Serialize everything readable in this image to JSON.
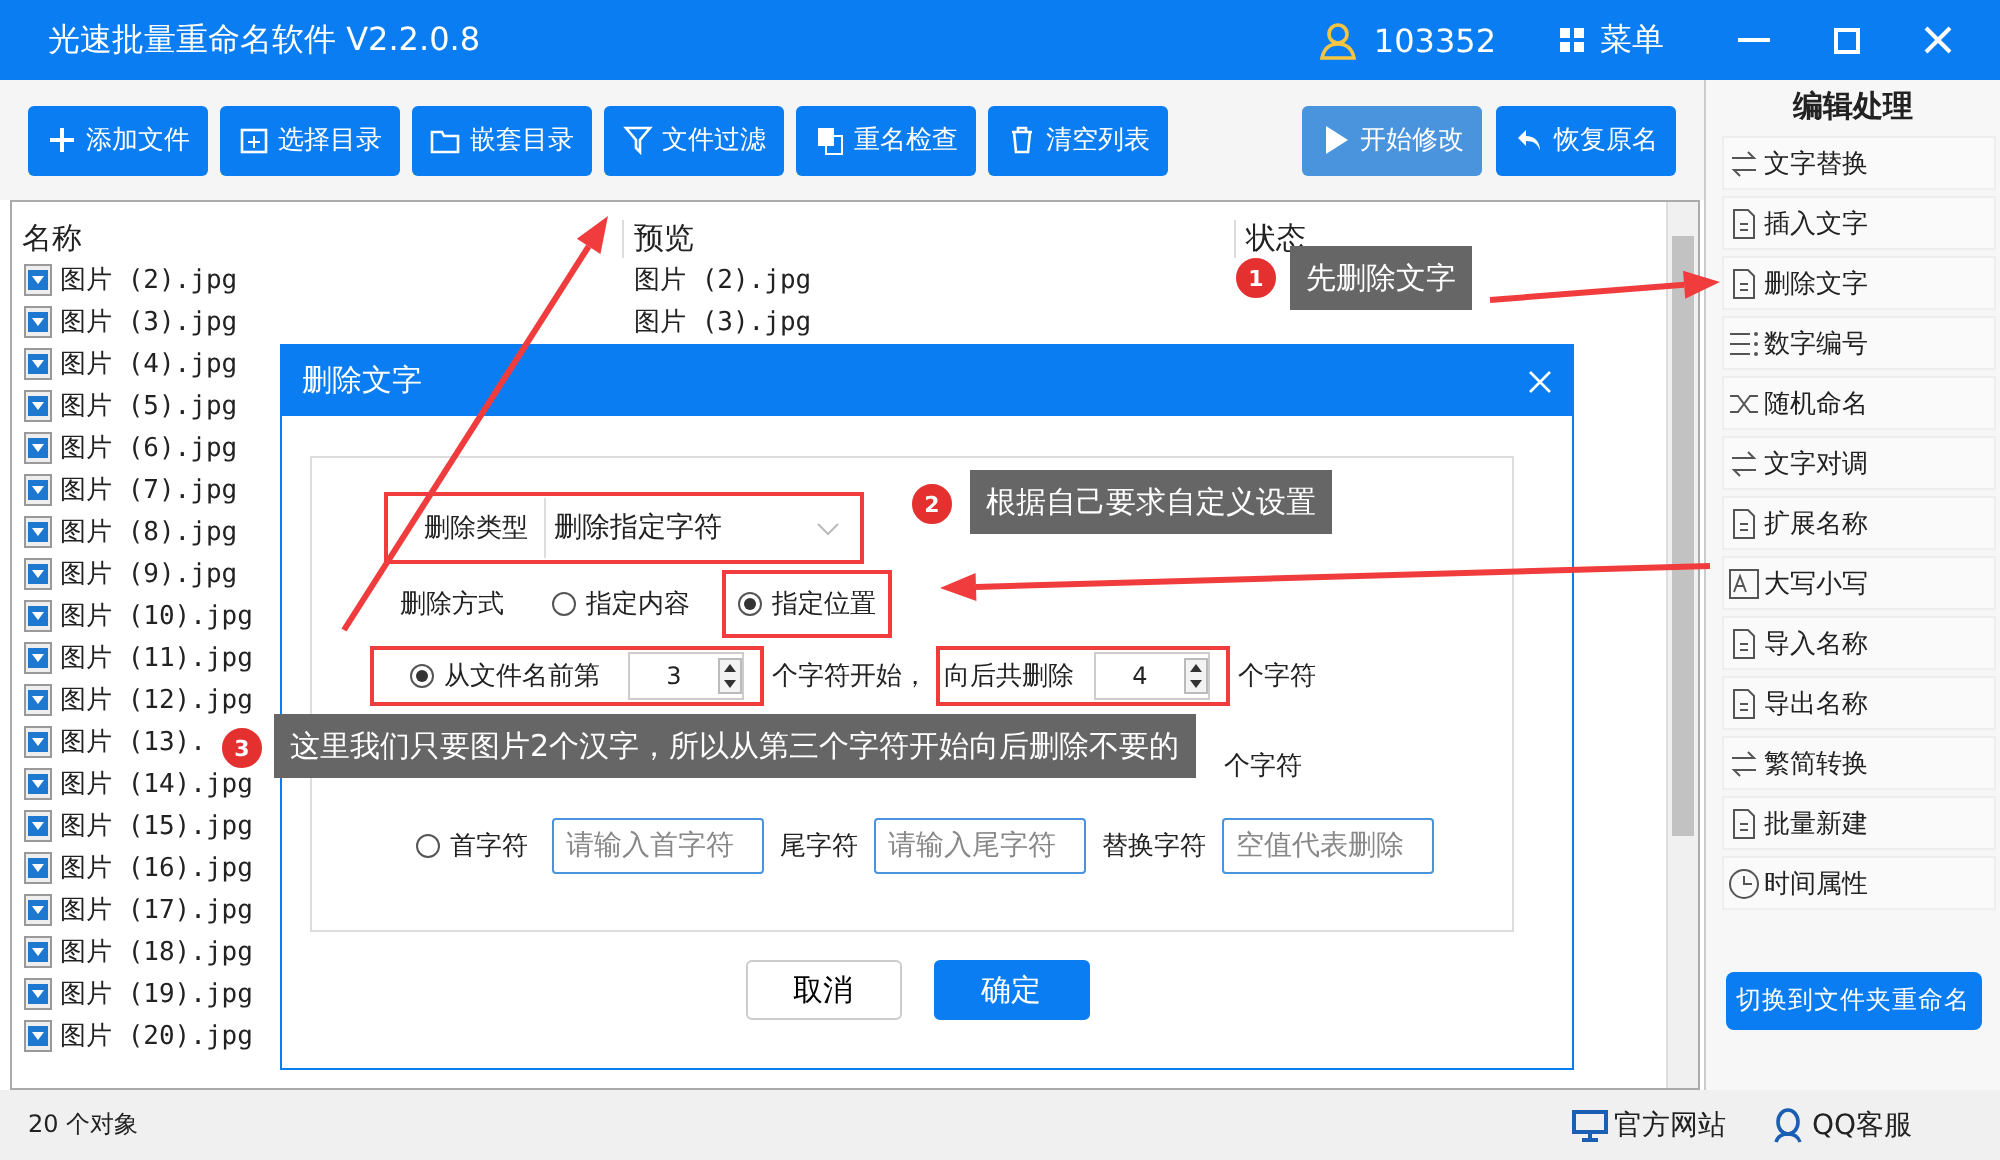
{
  "window": {
    "title": "光速批量重命名软件 V2.2.0.8",
    "user_id": "103352",
    "menu_label": "菜单"
  },
  "toolbar": [
    {
      "label": "添加文件",
      "disabled": false
    },
    {
      "label": "选择目录",
      "disabled": false
    },
    {
      "label": "嵌套目录",
      "disabled": false
    },
    {
      "label": "文件过滤",
      "disabled": false
    },
    {
      "label": "重名检查",
      "disabled": false
    },
    {
      "label": "清空列表",
      "disabled": false
    }
  ],
  "toolbar_right": [
    {
      "label": "开始修改",
      "disabled": true
    },
    {
      "label": "恢复原名",
      "disabled": false
    }
  ],
  "file_list": {
    "columns": [
      "名称",
      "预览",
      "状态"
    ],
    "rows": [
      {
        "name": "图片 (2).jpg",
        "preview": "图片 (2).jpg"
      },
      {
        "name": "图片 (3).jpg",
        "preview": "图片 (3).jpg"
      },
      {
        "name": "图片 (4).jpg"
      },
      {
        "name": "图片 (5).jpg"
      },
      {
        "name": "图片 (6).jpg"
      },
      {
        "name": "图片 (7).jpg"
      },
      {
        "name": "图片 (8).jpg"
      },
      {
        "name": "图片 (9).jpg"
      },
      {
        "name": "图片 (10).jpg"
      },
      {
        "name": "图片 (11).jpg"
      },
      {
        "name": "图片 (12).jpg"
      },
      {
        "name": "图片 (13)."
      },
      {
        "name": "图片 (14).jpg"
      },
      {
        "name": "图片 (15).jpg"
      },
      {
        "name": "图片 (16).jpg"
      },
      {
        "name": "图片 (17).jpg"
      },
      {
        "name": "图片 (18).jpg"
      },
      {
        "name": "图片 (19).jpg"
      },
      {
        "name": "图片 (20).jpg"
      }
    ]
  },
  "sidebar": {
    "title": "编辑处理",
    "items": [
      "文字替换",
      "插入文字",
      "删除文字",
      "数字编号",
      "随机命名",
      "文字对调",
      "扩展名称",
      "大写小写",
      "导入名称",
      "导出名称",
      "繁简转换",
      "批量新建",
      "时间属性"
    ],
    "switch_button": "切换到文件夹重命名"
  },
  "status_bar": {
    "count": "20 个对象",
    "links": [
      "官方网站",
      "QQ客服"
    ]
  },
  "dialog": {
    "title": "删除文字",
    "type_label": "删除类型",
    "type_value": "删除指定字符",
    "mode_label": "删除方式",
    "modes": [
      {
        "label": "指定内容",
        "selected": false
      },
      {
        "label": "指定位置",
        "selected": true
      }
    ],
    "front_option": {
      "selected": true,
      "label": "从文件名前第",
      "start": "3",
      "middle": "个字符开始，",
      "count_label": "向后共删除",
      "count": "4",
      "suffix": "个字符"
    },
    "back_option": {
      "suffix": "个字符"
    },
    "char_option": {
      "selected": false,
      "label": "首字符",
      "first_placeholder": "请输入首字符",
      "last_label": "尾字符",
      "last_placeholder": "请输入尾字符",
      "replace_label": "替换字符",
      "replace_placeholder": "空值代表删除"
    },
    "buttons": [
      "取消",
      "确定"
    ]
  },
  "annotations": [
    {
      "number": "1",
      "text": "先删除文字"
    },
    {
      "number": "2",
      "text": "根据自己要求自定义设置"
    },
    {
      "number": "3",
      "text": "这里我们只要图片2个汉字，所以从第三个字符开始向后删除不要的"
    }
  ]
}
